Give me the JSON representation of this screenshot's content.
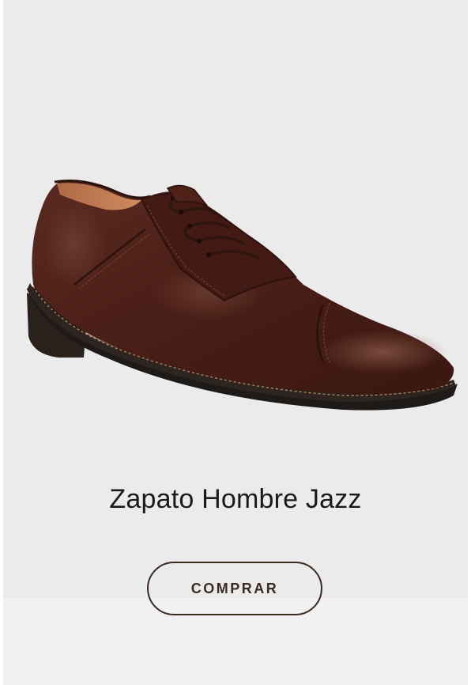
{
  "product": {
    "title": "Zapato Hombre Jazz",
    "image_icon": "brown-leather-cap-toe-oxford-shoe",
    "colors": {
      "leather": "#4a1f17",
      "sole": "#1e1a18",
      "stitch": "#b88a5a"
    }
  },
  "actions": {
    "buy_label": "COMPRAR"
  },
  "theme": {
    "card_background": "#ebebeb",
    "button_border": "#3b2a22"
  }
}
